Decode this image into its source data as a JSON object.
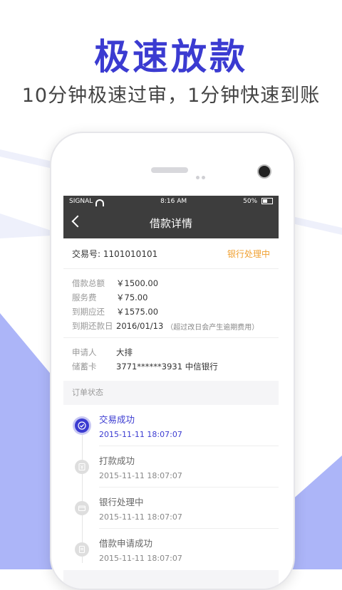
{
  "promo": {
    "headline": "极速放款",
    "subline": "10分钟极速过审，1分钟快速到账"
  },
  "status_bar": {
    "carrier": "SIGNAL",
    "time": "8:16 AM",
    "battery": "50%"
  },
  "nav": {
    "title": "借款详情"
  },
  "transaction": {
    "label": "交易号:",
    "number": "1101010101",
    "status": "银行处理中"
  },
  "details": [
    {
      "key": "借款总额",
      "value": "￥1500.00",
      "note": ""
    },
    {
      "key": "服务费",
      "value": "￥75.00",
      "note": ""
    },
    {
      "key": "到期应还",
      "value": "￥1575.00",
      "note": ""
    },
    {
      "key": "到期还款日",
      "value": "2016/01/13",
      "note": "（超过改日会产生逾期费用）"
    }
  ],
  "applicant": [
    {
      "key": "申请人",
      "value": "大排"
    },
    {
      "key": "储蓄卡",
      "value": "3771******3931 中信银行"
    }
  ],
  "order_status": {
    "title": "订单状态",
    "items": [
      {
        "title": "交易成功",
        "time": "2015-11-11 18:07:07",
        "icon": "check-icon",
        "active": true
      },
      {
        "title": "打款成功",
        "time": "2015-11-11 18:07:07",
        "icon": "money-icon",
        "active": false
      },
      {
        "title": "银行处理中",
        "time": "2015-11-11 18:07:07",
        "icon": "card-icon",
        "active": false
      },
      {
        "title": "借款申请成功",
        "time": "2015-11-11 18:07:07",
        "icon": "document-icon",
        "active": false
      }
    ]
  },
  "colors": {
    "accent": "#3b3bd1",
    "status_orange": "#f0a030",
    "navbar": "#3d3d3d"
  }
}
